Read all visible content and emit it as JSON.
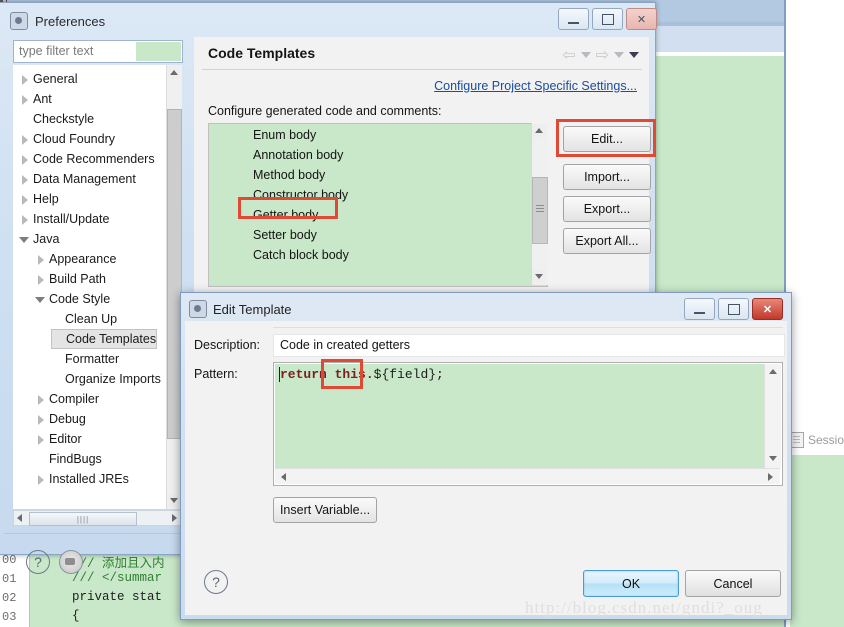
{
  "ide_background": {
    "session_label": "Sessio",
    "code_lines": [
      {
        "num": "00",
        "text": "/// 添加且入内"
      },
      {
        "num": "01",
        "text": "/// </summar"
      },
      {
        "num": "02",
        "text": "private stat"
      },
      {
        "num": "03",
        "text": "{"
      }
    ]
  },
  "preferences": {
    "title": "Preferences",
    "window_buttons": {
      "minimize": "minimize-icon",
      "maximize": "maximize-icon",
      "close": "close-icon"
    },
    "filter": {
      "placeholder": "type filter text",
      "value": ""
    },
    "tree": [
      {
        "label": "General",
        "expandable": true,
        "expanded": false,
        "indent": 0,
        "selected": false
      },
      {
        "label": "Ant",
        "expandable": true,
        "expanded": false,
        "indent": 0,
        "selected": false
      },
      {
        "label": "Checkstyle",
        "expandable": false,
        "expanded": false,
        "indent": 0,
        "selected": false
      },
      {
        "label": "Cloud Foundry",
        "expandable": true,
        "expanded": false,
        "indent": 0,
        "selected": false
      },
      {
        "label": "Code Recommenders",
        "expandable": true,
        "expanded": false,
        "indent": 0,
        "selected": false
      },
      {
        "label": "Data Management",
        "expandable": true,
        "expanded": false,
        "indent": 0,
        "selected": false
      },
      {
        "label": "Help",
        "expandable": true,
        "expanded": false,
        "indent": 0,
        "selected": false
      },
      {
        "label": "Install/Update",
        "expandable": true,
        "expanded": false,
        "indent": 0,
        "selected": false
      },
      {
        "label": "Java",
        "expandable": true,
        "expanded": true,
        "indent": 0,
        "selected": false
      },
      {
        "label": "Appearance",
        "expandable": true,
        "expanded": false,
        "indent": 1,
        "selected": false
      },
      {
        "label": "Build Path",
        "expandable": true,
        "expanded": false,
        "indent": 1,
        "selected": false
      },
      {
        "label": "Code Style",
        "expandable": true,
        "expanded": true,
        "indent": 1,
        "selected": false
      },
      {
        "label": "Clean Up",
        "expandable": false,
        "expanded": false,
        "indent": 2,
        "selected": false
      },
      {
        "label": "Code Templates",
        "expandable": false,
        "expanded": false,
        "indent": 2,
        "selected": true
      },
      {
        "label": "Formatter",
        "expandable": false,
        "expanded": false,
        "indent": 2,
        "selected": false
      },
      {
        "label": "Organize Imports",
        "expandable": false,
        "expanded": false,
        "indent": 2,
        "selected": false
      },
      {
        "label": "Compiler",
        "expandable": true,
        "expanded": false,
        "indent": 1,
        "selected": false
      },
      {
        "label": "Debug",
        "expandable": true,
        "expanded": false,
        "indent": 1,
        "selected": false
      },
      {
        "label": "Editor",
        "expandable": true,
        "expanded": false,
        "indent": 1,
        "selected": false
      },
      {
        "label": "FindBugs",
        "expandable": false,
        "expanded": false,
        "indent": 1,
        "selected": false
      },
      {
        "label": "Installed JREs",
        "expandable": true,
        "expanded": false,
        "indent": 1,
        "selected": false
      }
    ],
    "panel": {
      "title": "Code Templates",
      "configure_link": "Configure Project Specific Settings...",
      "list_label": "Configure generated code and comments:",
      "list_items": [
        "Enum body",
        "Annotation body",
        "Method body",
        "Constructor body",
        "Getter body",
        "Setter body",
        "Catch block body"
      ],
      "selected_item": "Getter body",
      "buttons": [
        {
          "label": "Edit...",
          "highlighted": true
        },
        {
          "label": "Import...",
          "highlighted": false
        },
        {
          "label": "Export...",
          "highlighted": false
        },
        {
          "label": "Export All...",
          "highlighted": false
        }
      ]
    },
    "footer": {
      "help": "?",
      "apply_icon": "apply-icon"
    }
  },
  "edit_template_dialog": {
    "title": "Edit Template",
    "window_buttons": {
      "minimize": "minimize-icon",
      "maximize": "maximize-icon",
      "close": "close-icon"
    },
    "description_label": "Description:",
    "description_value": "Code in created getters",
    "pattern_label": "Pattern:",
    "pattern_tokens": [
      {
        "text": "return",
        "kind": "keyword"
      },
      {
        "text": " ",
        "kind": "plain"
      },
      {
        "text": "this.",
        "kind": "keyword"
      },
      {
        "text": "${field};",
        "kind": "plain"
      }
    ],
    "pattern_full": "return this.${field};",
    "insert_variable_label": "Insert Variable...",
    "help": "?",
    "ok_label": "OK",
    "cancel_label": "Cancel"
  },
  "watermark": "http://blog.csdn.net/gndi?_oug",
  "colors": {
    "highlight_red": "#e04a35",
    "editor_green": "#c9e8c9",
    "link_blue": "#1a4d9c",
    "keyword_maroon": "#7a2020"
  }
}
